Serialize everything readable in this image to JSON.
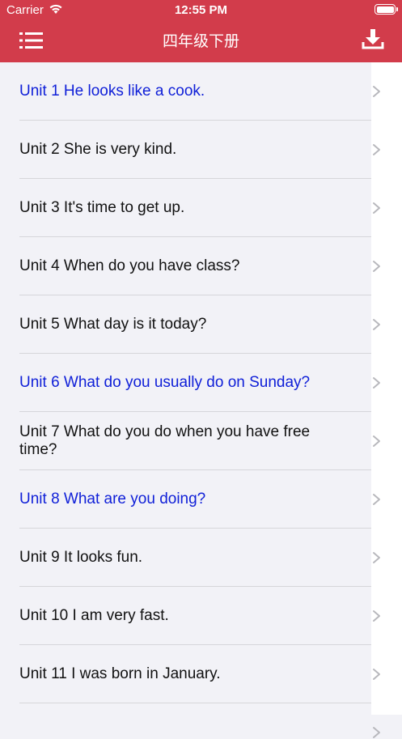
{
  "status": {
    "carrier": "Carrier",
    "time": "12:55 PM"
  },
  "nav": {
    "title": "四年级下册"
  },
  "units": [
    {
      "label": "Unit 1 He looks like a cook.",
      "highlight": true
    },
    {
      "label": "Unit 2 She is very kind.",
      "highlight": false
    },
    {
      "label": "Unit 3 It's time to get up.",
      "highlight": false
    },
    {
      "label": "Unit 4 When do you have class?",
      "highlight": false
    },
    {
      "label": "Unit 5 What day is it today?",
      "highlight": false
    },
    {
      "label": "Unit 6 What do you usually do on Sunday?",
      "highlight": true
    },
    {
      "label": "Unit 7 What do you do when you have free time?",
      "highlight": false
    },
    {
      "label": "Unit 8 What are you doing?",
      "highlight": true
    },
    {
      "label": "Unit 9 It looks fun.",
      "highlight": false
    },
    {
      "label": "Unit 10 I am very fast.",
      "highlight": false
    },
    {
      "label": "Unit 11 I was born in January.",
      "highlight": false
    },
    {
      "label": "",
      "highlight": false
    }
  ],
  "colors": {
    "header": "#d23c4b",
    "highlight_text": "#1020d8",
    "normal_text": "#111111"
  }
}
